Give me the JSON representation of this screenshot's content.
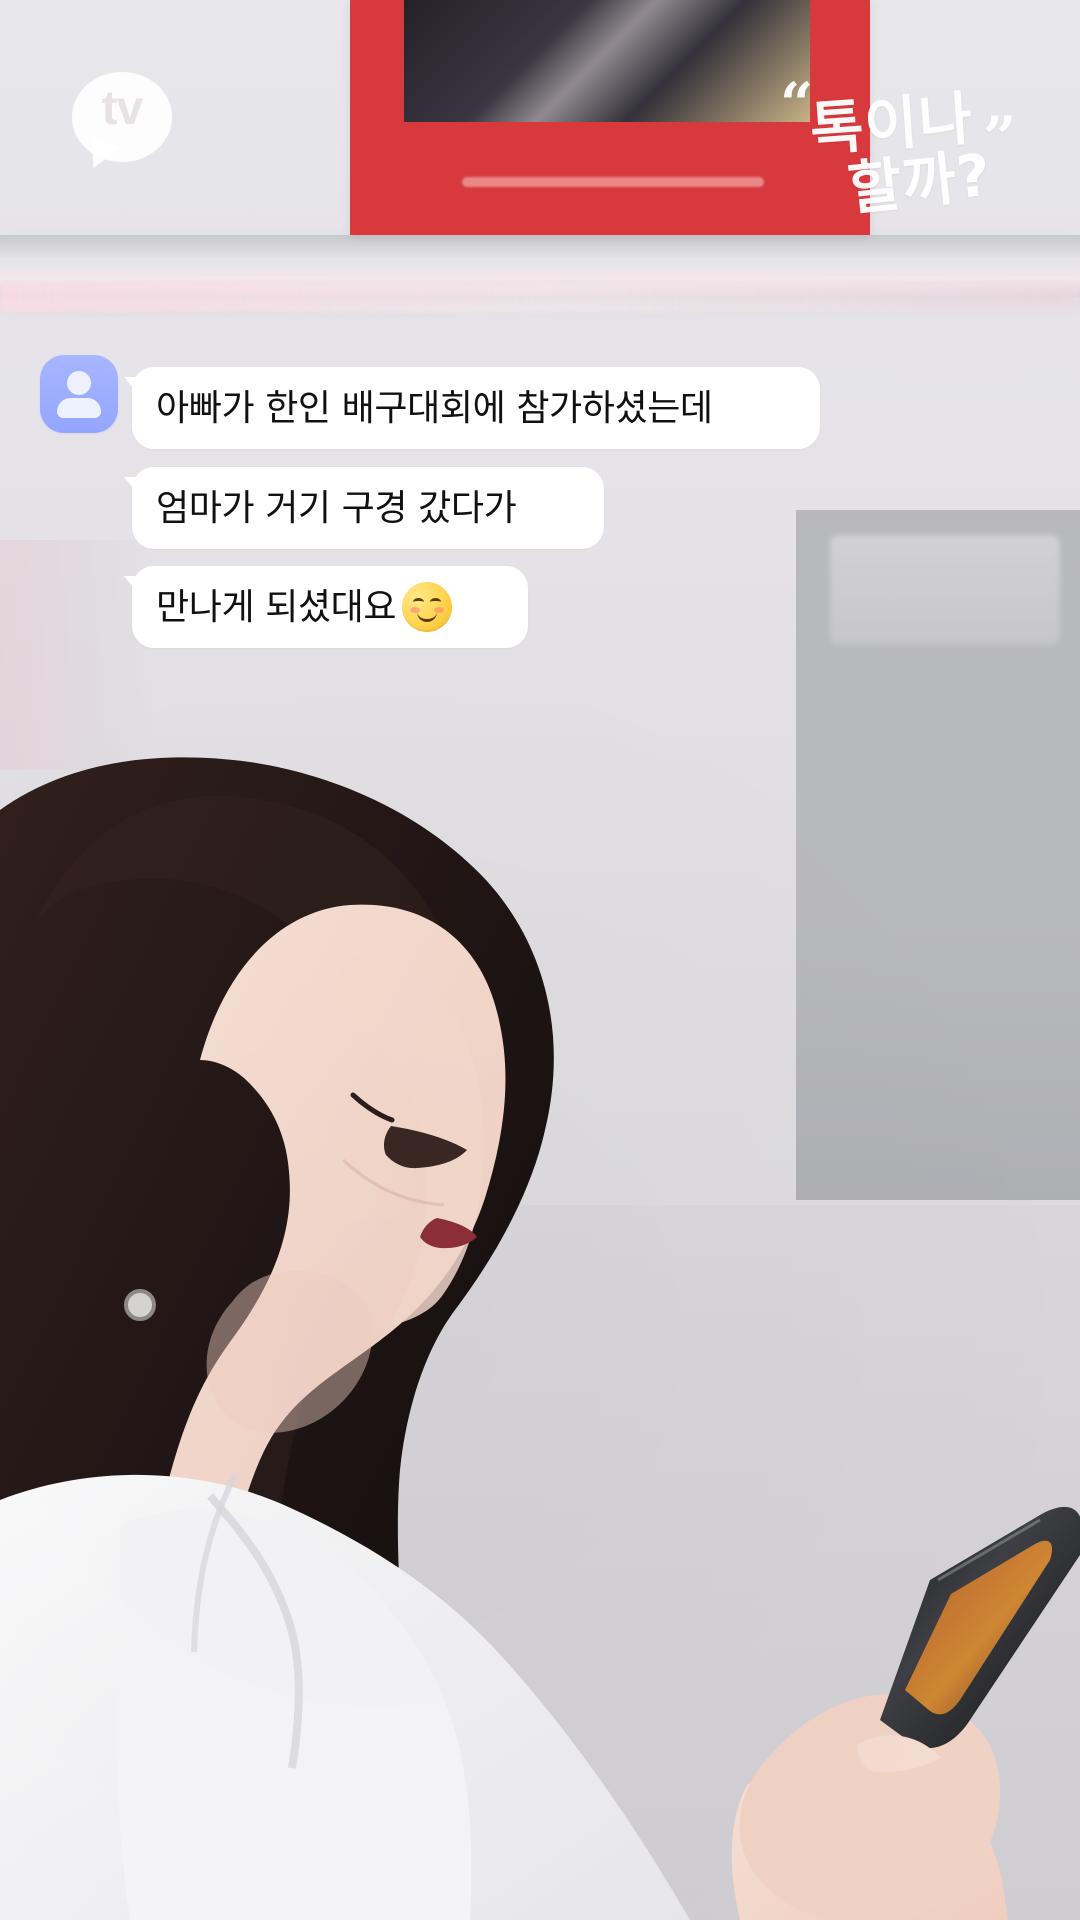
{
  "brand": {
    "tv_logo_text": "tv",
    "quote_open": "“",
    "title_line_1": "톡이나",
    "title_line_2": "할까?",
    "quote_close": "”"
  },
  "chat": {
    "messages": [
      {
        "text": "아빠가 한인 배구대회에 참가하셨는데"
      },
      {
        "text": "엄마가 거기 구경 갔다가"
      },
      {
        "text": "만나게 되셨대요",
        "emoji": "smiling-face-icon"
      }
    ]
  },
  "colors": {
    "avatar": "#9aaeff",
    "bubble": "#ffffff",
    "poster_red": "#d7393d"
  }
}
